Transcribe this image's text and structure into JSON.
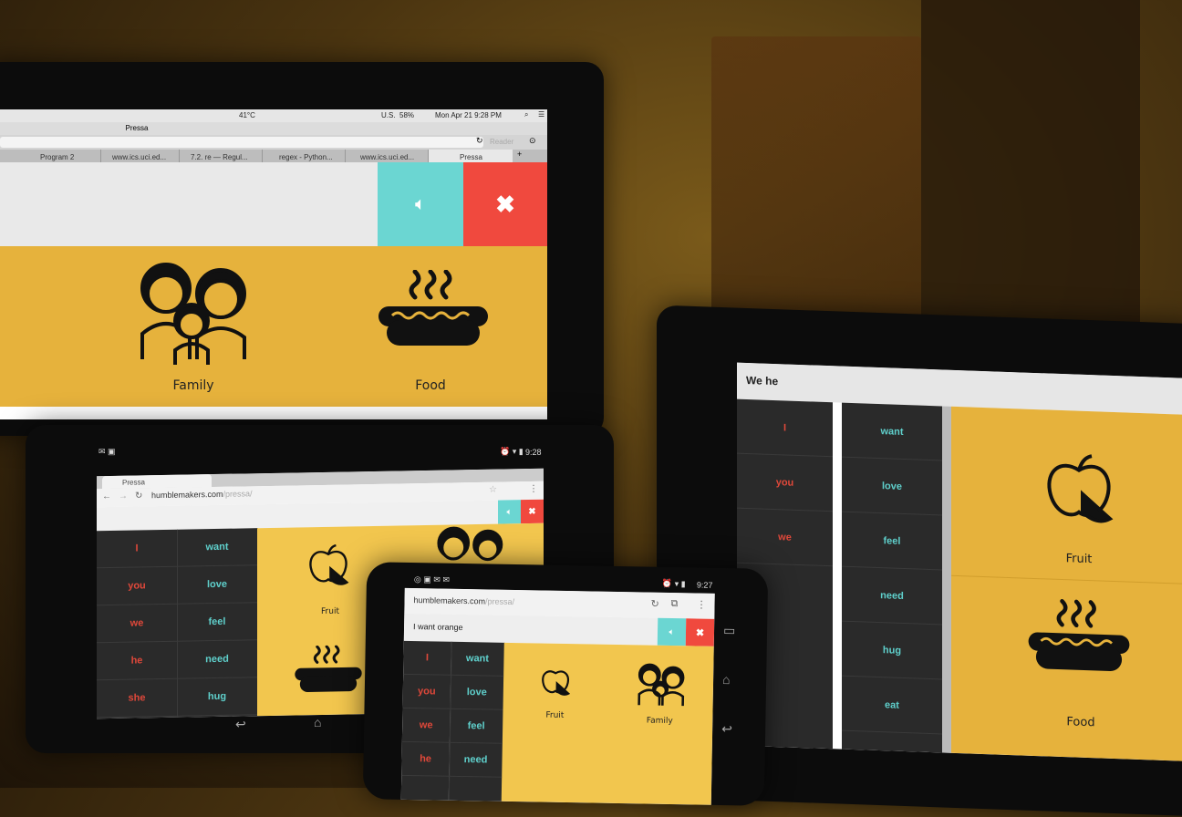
{
  "laptop": {
    "menubar": {
      "temp": "41°C",
      "battery": "58%",
      "locale": "U.S.",
      "datetime": "Mon Apr 21  9:28 PM"
    },
    "window_title": "Pressa",
    "reader": "Reader",
    "tabs": [
      "Program 2",
      "www.ics.uci.ed...",
      "7.2. re — Regul...",
      "regex - Python...",
      "www.ics.uci.ed...",
      "Pressa"
    ],
    "tiles": [
      {
        "label": "Family"
      },
      {
        "label": "Food"
      }
    ]
  },
  "tablet_left": {
    "status_time": "9:28",
    "tab_title": "Pressa",
    "url_host": "humblemakers.com",
    "url_path": "/pressa/",
    "subjects": [
      "I",
      "you",
      "we",
      "he",
      "she"
    ],
    "verbs": [
      "want",
      "love",
      "feel",
      "need",
      "hug"
    ],
    "tiles": [
      {
        "label": "Fruit"
      }
    ]
  },
  "phone": {
    "status_time": "9:27",
    "url_host": "humblemakers.com",
    "url_path": "/pressa/",
    "sentence": "I want orange",
    "subjects": [
      "I",
      "you",
      "we",
      "he"
    ],
    "verbs": [
      "want",
      "love",
      "feel",
      "need"
    ],
    "tiles": [
      {
        "label": "Fruit"
      },
      {
        "label": "Family"
      }
    ]
  },
  "tablet_right": {
    "sentence": "We he",
    "subjects": [
      "I",
      "you",
      "we"
    ],
    "verbs": [
      "want",
      "love",
      "feel",
      "need",
      "hug",
      "eat"
    ],
    "tiles": [
      {
        "label": "Fruit"
      },
      {
        "label": "Food"
      }
    ]
  },
  "colors": {
    "gold": "#e6b23c",
    "teal": "#6bd6d2",
    "red": "#f0493e",
    "dark": "#2a2a2a"
  },
  "icons": [
    "family-icon",
    "hotdog-icon",
    "apple-icon",
    "speaker-icon",
    "close-icon"
  ]
}
